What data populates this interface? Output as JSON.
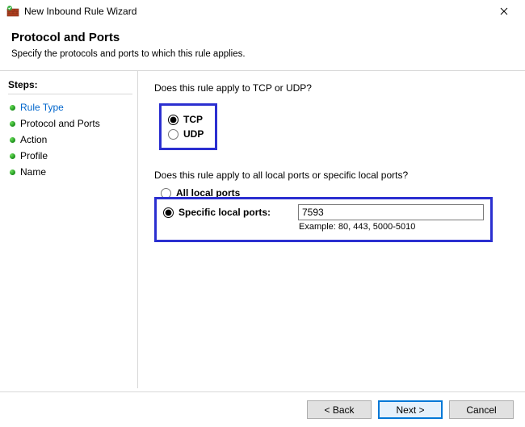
{
  "window": {
    "title": "New Inbound Rule Wizard"
  },
  "header": {
    "title": "Protocol and Ports",
    "subtitle": "Specify the protocols and ports to which this rule applies."
  },
  "sidebar": {
    "heading": "Steps:",
    "items": [
      {
        "label": "Rule Type"
      },
      {
        "label": "Protocol and Ports"
      },
      {
        "label": "Action"
      },
      {
        "label": "Profile"
      },
      {
        "label": "Name"
      }
    ]
  },
  "main": {
    "question_protocol": "Does this rule apply to TCP or UDP?",
    "protocol": {
      "tcp": "TCP",
      "udp": "UDP",
      "selected": "TCP"
    },
    "question_ports": "Does this rule apply to all local ports or specific local ports?",
    "ports": {
      "all_label": "All local ports",
      "specific_label": "Specific local ports:",
      "selected": "specific",
      "value": "7593",
      "example": "Example: 80, 443, 5000-5010"
    }
  },
  "footer": {
    "back": "< Back",
    "next": "Next >",
    "cancel": "Cancel"
  }
}
